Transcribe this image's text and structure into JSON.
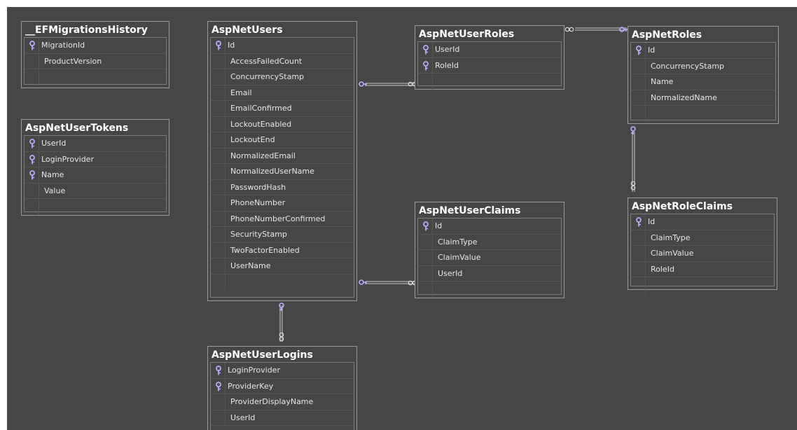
{
  "diagram": {
    "tables": [
      {
        "id": "efmigrationshistory",
        "title": "__EFMigrationsHistory",
        "columns": [
          {
            "name": "MigrationId",
            "pk": true
          },
          {
            "name": "ProductVersion",
            "pk": false
          }
        ]
      },
      {
        "id": "aspnetusers",
        "title": "AspNetUsers",
        "columns": [
          {
            "name": "Id",
            "pk": true
          },
          {
            "name": "AccessFailedCount",
            "pk": false
          },
          {
            "name": "ConcurrencyStamp",
            "pk": false
          },
          {
            "name": "Email",
            "pk": false
          },
          {
            "name": "EmailConfirmed",
            "pk": false
          },
          {
            "name": "LockoutEnabled",
            "pk": false
          },
          {
            "name": "LockoutEnd",
            "pk": false
          },
          {
            "name": "NormalizedEmail",
            "pk": false
          },
          {
            "name": "NormalizedUserName",
            "pk": false
          },
          {
            "name": "PasswordHash",
            "pk": false
          },
          {
            "name": "PhoneNumber",
            "pk": false
          },
          {
            "name": "PhoneNumberConfirmed",
            "pk": false
          },
          {
            "name": "SecurityStamp",
            "pk": false
          },
          {
            "name": "TwoFactorEnabled",
            "pk": false
          },
          {
            "name": "UserName",
            "pk": false
          }
        ]
      },
      {
        "id": "aspnetuserroles",
        "title": "AspNetUserRoles",
        "columns": [
          {
            "name": "UserId",
            "pk": true
          },
          {
            "name": "RoleId",
            "pk": true
          }
        ]
      },
      {
        "id": "aspnetroles",
        "title": "AspNetRoles",
        "columns": [
          {
            "name": "Id",
            "pk": true
          },
          {
            "name": "ConcurrencyStamp",
            "pk": false
          },
          {
            "name": "Name",
            "pk": false
          },
          {
            "name": "NormalizedName",
            "pk": false
          }
        ]
      },
      {
        "id": "aspnetusertokens",
        "title": "AspNetUserTokens",
        "columns": [
          {
            "name": "UserId",
            "pk": true
          },
          {
            "name": "LoginProvider",
            "pk": true
          },
          {
            "name": "Name",
            "pk": true
          },
          {
            "name": "Value",
            "pk": false
          }
        ]
      },
      {
        "id": "aspnetuserclaims",
        "title": "AspNetUserClaims",
        "columns": [
          {
            "name": "Id",
            "pk": true
          },
          {
            "name": "ClaimType",
            "pk": false
          },
          {
            "name": "ClaimValue",
            "pk": false
          },
          {
            "name": "UserId",
            "pk": false
          }
        ]
      },
      {
        "id": "aspnetroleclaims",
        "title": "AspNetRoleClaims",
        "columns": [
          {
            "name": "Id",
            "pk": true
          },
          {
            "name": "ClaimType",
            "pk": false
          },
          {
            "name": "ClaimValue",
            "pk": false
          },
          {
            "name": "RoleId",
            "pk": false
          }
        ]
      },
      {
        "id": "aspnetuserlogins",
        "title": "AspNetUserLogins",
        "columns": [
          {
            "name": "LoginProvider",
            "pk": true
          },
          {
            "name": "ProviderKey",
            "pk": true
          },
          {
            "name": "ProviderDisplayName",
            "pk": false
          },
          {
            "name": "UserId",
            "pk": false
          }
        ]
      }
    ],
    "relationships": [
      {
        "from": "aspnetusers",
        "to": "aspnetuserroles",
        "one_end": "key-icon",
        "many_end": "infinity-icon"
      },
      {
        "from": "aspnetroles",
        "to": "aspnetuserroles",
        "one_end": "key-icon",
        "many_end": "infinity-icon"
      },
      {
        "from": "aspnetusers",
        "to": "aspnetuserclaims",
        "one_end": "key-icon",
        "many_end": "infinity-icon"
      },
      {
        "from": "aspnetroles",
        "to": "aspnetroleclaims",
        "one_end": "key-icon",
        "many_end": "infinity-icon"
      },
      {
        "from": "aspnetusers",
        "to": "aspnetuserlogins",
        "one_end": "key-icon",
        "many_end": "infinity-icon"
      }
    ],
    "colors": {
      "canvas_background": "#464646",
      "table_border": "#9b9b9b",
      "title_text": "#ffffff",
      "column_text": "#e8e8e8",
      "relationship_line": "#cccccc",
      "key_icon": "#b8b0ff"
    }
  }
}
